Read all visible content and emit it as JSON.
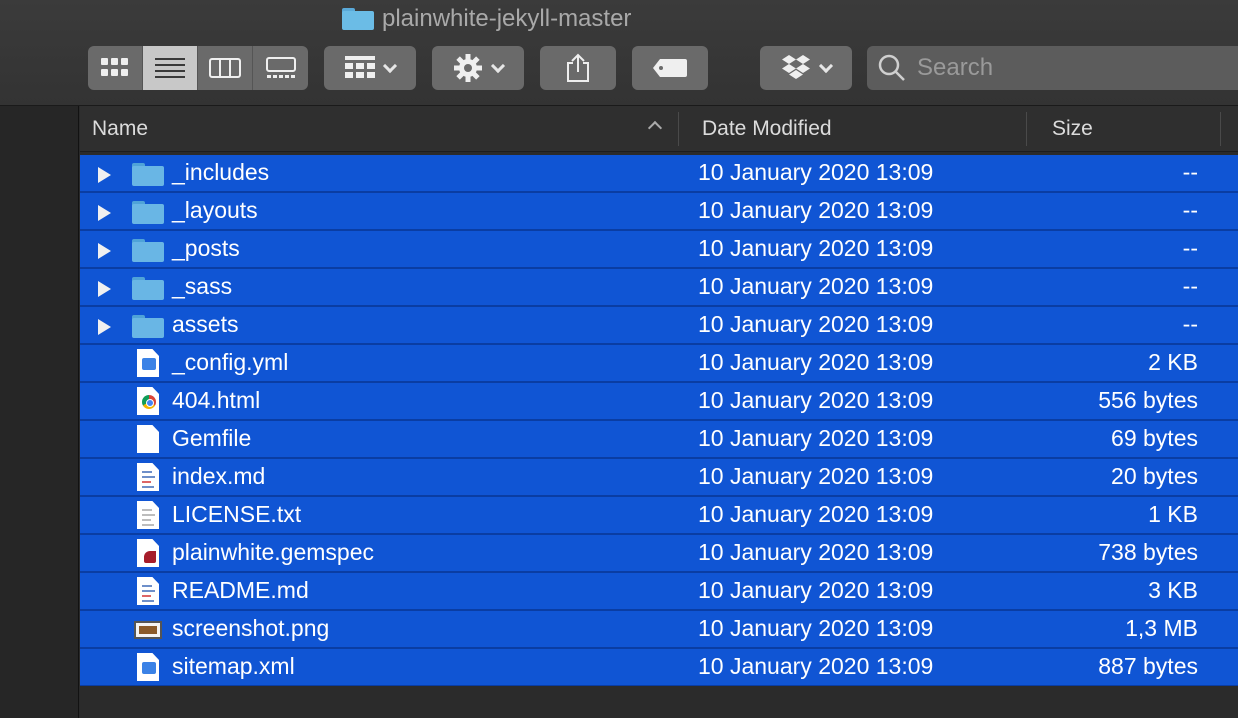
{
  "window": {
    "title": "plainwhite-jekyll-master"
  },
  "toolbar": {
    "view_modes": [
      "icon-view-icon",
      "list-view-icon",
      "column-view-icon",
      "gallery-view-icon"
    ],
    "active_view": 1,
    "search_placeholder": "Search"
  },
  "columns": {
    "name": "Name",
    "date": "Date Modified",
    "size": "Size"
  },
  "files": [
    {
      "name": "_includes",
      "date": "10 January 2020 13:09",
      "size": "--",
      "kind": "folder"
    },
    {
      "name": "_layouts",
      "date": "10 January 2020 13:09",
      "size": "--",
      "kind": "folder"
    },
    {
      "name": "_posts",
      "date": "10 January 2020 13:09",
      "size": "--",
      "kind": "folder"
    },
    {
      "name": "_sass",
      "date": "10 January 2020 13:09",
      "size": "--",
      "kind": "folder"
    },
    {
      "name": "assets",
      "date": "10 January 2020 13:09",
      "size": "--",
      "kind": "folder"
    },
    {
      "name": "_config.yml",
      "date": "10 January 2020 13:09",
      "size": "2 KB",
      "kind": "xcode"
    },
    {
      "name": "404.html",
      "date": "10 January 2020 13:09",
      "size": "556 bytes",
      "kind": "chrome"
    },
    {
      "name": "Gemfile",
      "date": "10 January 2020 13:09",
      "size": "69 bytes",
      "kind": "blank"
    },
    {
      "name": "index.md",
      "date": "10 January 2020 13:09",
      "size": "20 bytes",
      "kind": "text"
    },
    {
      "name": "LICENSE.txt",
      "date": "10 January 2020 13:09",
      "size": "1 KB",
      "kind": "plain"
    },
    {
      "name": "plainwhite.gemspec",
      "date": "10 January 2020 13:09",
      "size": "738 bytes",
      "kind": "ruby"
    },
    {
      "name": "README.md",
      "date": "10 January 2020 13:09",
      "size": "3 KB",
      "kind": "text"
    },
    {
      "name": "screenshot.png",
      "date": "10 January 2020 13:09",
      "size": "1,3 MB",
      "kind": "image"
    },
    {
      "name": "sitemap.xml",
      "date": "10 January 2020 13:09",
      "size": "887 bytes",
      "kind": "xcode"
    }
  ],
  "colors": {
    "selection": "#1055d4",
    "folder": "#69b6e5"
  }
}
